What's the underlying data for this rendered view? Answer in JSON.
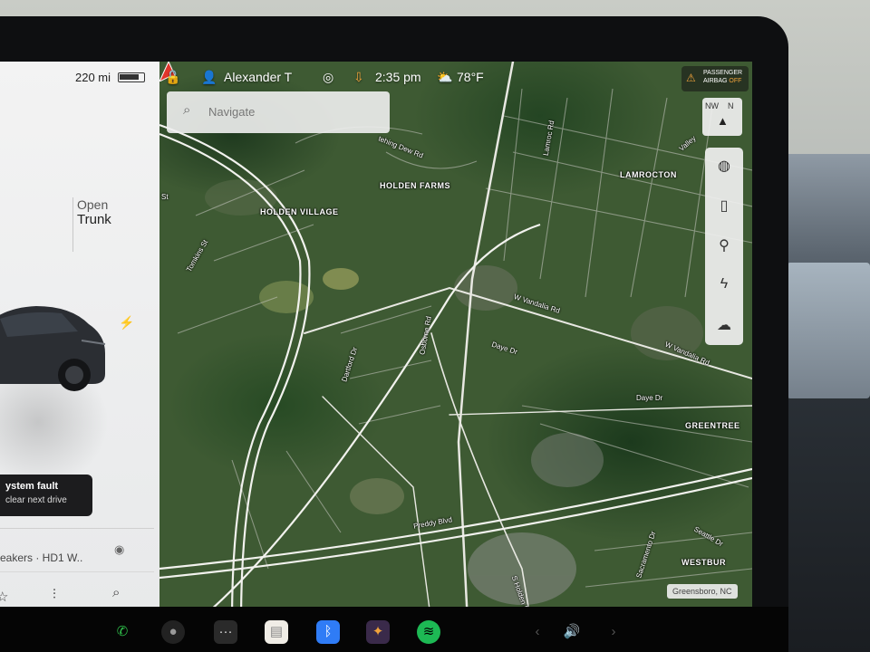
{
  "vehicle": {
    "range": "220 mi",
    "battery_level": 0.85,
    "trunk_open_label": "Open",
    "trunk_label": "Trunk",
    "charge_icon": "bolt-icon"
  },
  "alert": {
    "title": "ystem fault",
    "subtitle": "clear next drive"
  },
  "media": {
    "title": "eakers · HD1 W..",
    "source_icon": "radio-source-icon"
  },
  "status": {
    "driver": "Alexander T",
    "time": "2:35 pm",
    "temperature": "78°F",
    "airbag_line1": "PASSENGER",
    "airbag_line2": "AIRBAG",
    "airbag_line3": "OFF"
  },
  "search": {
    "placeholder": "Navigate"
  },
  "compass": {
    "heading_a": "NW",
    "heading_b": "N"
  },
  "map": {
    "area_labels": [
      "HOLDEN VILLAGE",
      "HOLDEN FARMS",
      "LAMROCTON",
      "GREENTREE",
      "WESTBUR"
    ],
    "road_labels": [
      "Tomkins St",
      "St",
      "Dartford Dr",
      "Osborne Rd",
      "W Vandalia Rd",
      "Daye Dr",
      "W Vandalia Rd",
      "Daye Dr",
      "Preddy Blvd",
      "S Holden Rd",
      "Lamroc Rd",
      "Seattle Dr",
      "Sacramento Dr",
      "tehing Dew Rd",
      "Valley"
    ],
    "city": "Greensboro, NC"
  },
  "colors": {
    "nav_arrow": "#e0352b",
    "airbag_accent": "#f1a33b",
    "spotify": "#1db954",
    "phone": "#2fbf4a",
    "bluetooth": "#2f7cf6"
  }
}
